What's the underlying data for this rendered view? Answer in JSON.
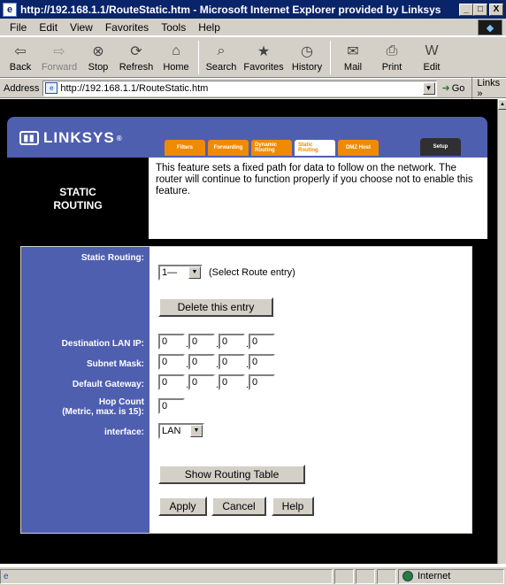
{
  "window": {
    "title": "http://192.168.1.1/RouteStatic.htm - Microsoft Internet Explorer provided by Linksys",
    "min": "_",
    "max": "□",
    "close": "X"
  },
  "menu": [
    {
      "label": "File"
    },
    {
      "label": "Edit"
    },
    {
      "label": "View"
    },
    {
      "label": "Favorites"
    },
    {
      "label": "Tools"
    },
    {
      "label": "Help"
    }
  ],
  "toolbar": {
    "back": "Back",
    "forward": "Forward",
    "stop": "Stop",
    "refresh": "Refresh",
    "home": "Home",
    "search": "Search",
    "favorites": "Favorites",
    "history": "History",
    "mail": "Mail",
    "print": "Print",
    "edit": "Edit"
  },
  "address": {
    "label": "Address",
    "url": "http://192.168.1.1/RouteStatic.htm",
    "go": "Go",
    "links": "Links »"
  },
  "linksys": {
    "brand": "LINKSYS",
    "tabs": [
      "Filters",
      "Forwarding",
      "Dynamic Routing",
      "Static Routing",
      "DMZ Host"
    ],
    "setup_tab": "Setup",
    "section_title_1": "STATIC",
    "section_title_2": "ROUTING",
    "intro": "This feature sets a fixed path for data to follow on the network. The router will continue to function properly if you choose not to enable this feature."
  },
  "form": {
    "static_routing_label": "Static Routing:",
    "route_entry": "1—",
    "route_hint": "(Select Route entry)",
    "delete_button": "Delete this entry",
    "dest_label": "Destination LAN IP:",
    "dest_ip": [
      "0",
      "0",
      "0",
      "0"
    ],
    "mask_label": "Subnet Mask:",
    "mask": [
      "0",
      "0",
      "0",
      "0"
    ],
    "gateway_label": "Default Gateway:",
    "gateway": [
      "0",
      "0",
      "0",
      "0"
    ],
    "hop_label_1": "Hop Count",
    "hop_label_2": "(Metric, max. is 15):",
    "hop": "0",
    "interface_label": "interface:",
    "interface_value": "LAN",
    "show_table_button": "Show Routing Table",
    "apply_button": "Apply",
    "cancel_button": "Cancel",
    "help_button": "Help"
  },
  "status": {
    "zone": "Internet"
  }
}
